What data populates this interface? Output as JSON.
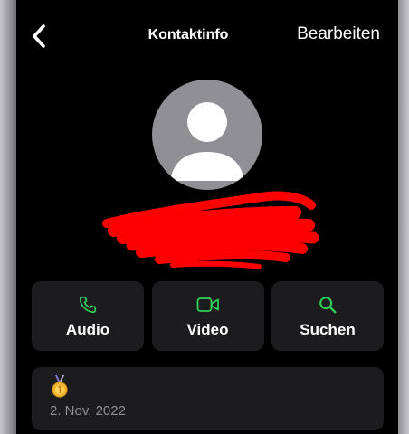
{
  "navbar": {
    "back_icon": "chevron-left-icon",
    "title": "Kontaktinfo",
    "edit_label": "Bearbeiten"
  },
  "profile": {
    "avatar_icon": "person-silhouette-icon",
    "name_redacted": true,
    "redaction_color": "#ff0000"
  },
  "actions": [
    {
      "label": "Audio",
      "icon": "phone-icon"
    },
    {
      "label": "Video",
      "icon": "video-camera-icon"
    },
    {
      "label": "Suchen",
      "icon": "search-icon"
    }
  ],
  "about": {
    "status_emoji": "🥇",
    "date": "2. Nov. 2022"
  },
  "colors": {
    "accent_green": "#30d158",
    "background": "#000000",
    "card": "#1c1c1e",
    "secondary_text": "#8e8e93"
  }
}
